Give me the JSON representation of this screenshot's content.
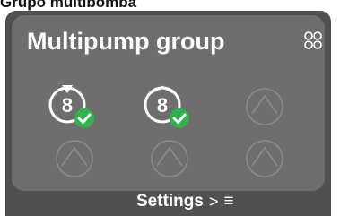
{
  "caption": "Grupo multibomba",
  "panel": {
    "title": "Multipump group"
  },
  "pumps": [
    {
      "number": "8",
      "status": "running",
      "active": true
    },
    {
      "number": "8",
      "status": "ok",
      "active": true
    },
    {
      "number": "",
      "status": "empty",
      "active": false
    },
    {
      "number": "",
      "status": "empty",
      "active": false
    },
    {
      "number": "",
      "status": "empty",
      "active": false
    },
    {
      "number": "",
      "status": "empty",
      "active": false
    }
  ],
  "footer": {
    "settings_label": "Settings",
    "chevron": ">",
    "menu_glyph": "≡"
  },
  "colors": {
    "device_bg": "#505050",
    "panel_bg": "#6e6e6e",
    "ok_green": "#2fb24c",
    "empty_outline": "#8a8a8a"
  },
  "icons": [
    "group-settings-icon",
    "pump-icon",
    "check-badge-icon",
    "running-indicator-icon",
    "hamburger-menu-icon"
  ]
}
